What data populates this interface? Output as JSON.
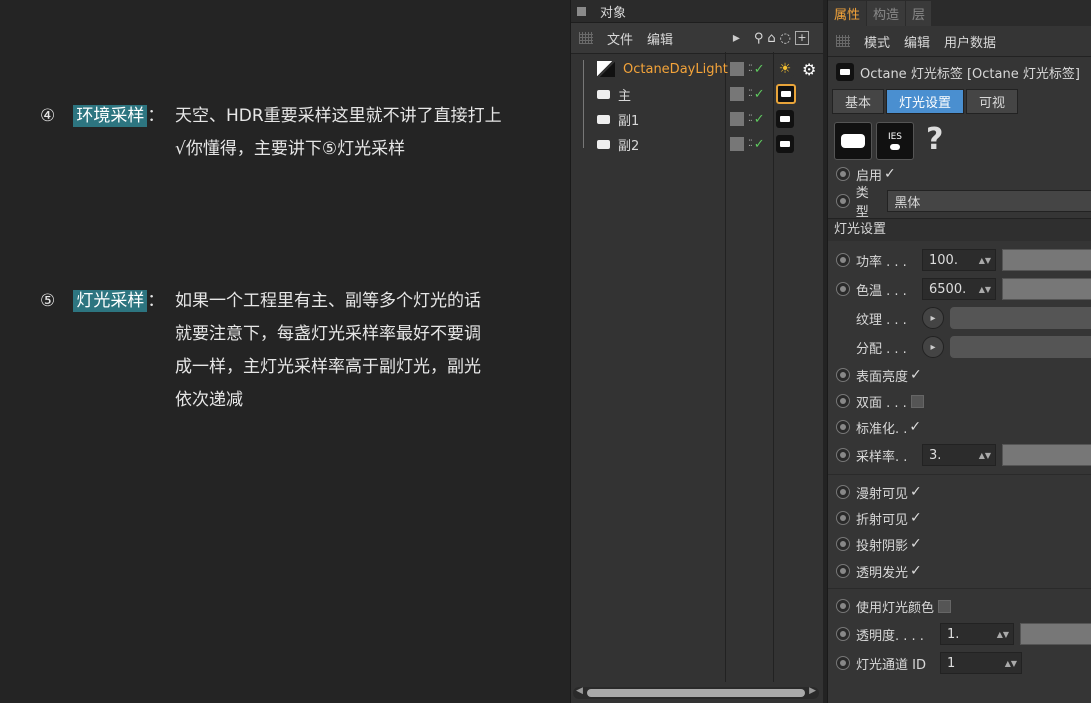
{
  "notes": [
    {
      "num": "④",
      "tag": "环境采样",
      "colon": "：",
      "line1": "天空、HDR重要采样这里就不讲了直接打上",
      "line2": "√你懂得，主要讲下⑤灯光采样"
    },
    {
      "num": "⑤",
      "tag": "灯光采样",
      "colon": "：",
      "line1": "如果一个工程里有主、副等多个灯光的话",
      "line2": "就要注意下，每盏灯光采样率最好不要调",
      "line3": "成一样，主灯光采样率高于副灯光，副光",
      "line4": "依次递减"
    }
  ],
  "objects_panel": {
    "title": "对象",
    "menu": [
      "文件",
      "编辑"
    ],
    "items": [
      {
        "name": "OctaneDayLight",
        "color": "#f4a43a"
      },
      {
        "name": "主",
        "color": "#d8d8d8"
      },
      {
        "name": "副1",
        "color": "#d8d8d8"
      },
      {
        "name": "副2",
        "color": "#d8d8d8"
      }
    ]
  },
  "attributes_panel": {
    "tabs": [
      "属性",
      "构造",
      "层"
    ],
    "menu": [
      "模式",
      "编辑",
      "用户数据"
    ],
    "header": "Octane 灯光标签 [Octane 灯光标签]",
    "subtabs": [
      "基本",
      "灯光设置",
      "可视"
    ],
    "ies_label": "IES",
    "help": "?",
    "enable_label": "启用",
    "type_label": "类型",
    "type_value": "黑体",
    "section_title": "灯光设置",
    "power_label": "功率 . . .",
    "power_value": "100.",
    "temp_label": "色温 . . .",
    "temp_value": "6500.",
    "texture_label": "纹理 . . .",
    "distribution_label": "分配 . . .",
    "surface_label": "表面亮度",
    "double_label": "双面 . . .",
    "normalize_label": "标准化. .",
    "sample_label": "采样率. .",
    "sample_value": "3.",
    "diffuse_label": "漫射可见",
    "refraction_label": "折射可见",
    "shadow_label": "投射阴影",
    "transparent_label": "透明发光",
    "use_color_label": "使用灯光颜色",
    "opacity_label": "透明度. . . .",
    "opacity_value": "1.",
    "pass_label": "灯光通道 ID",
    "pass_value": "1"
  }
}
